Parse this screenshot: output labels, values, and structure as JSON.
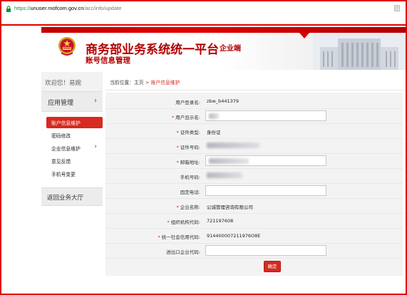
{
  "browser": {
    "url_scheme": "https://",
    "url_host": "unuser.mofcom.gov.cn",
    "url_path": "/acc/info/update"
  },
  "header": {
    "title": "商务部业务系统统一平台",
    "suffix": "企业端",
    "subtitle": "账号信息管理"
  },
  "sidebar": {
    "welcome": "欢迎您！易婉",
    "menu_head": "应用管理",
    "menu_arrow": "›",
    "items": [
      {
        "label": "账户信息维护",
        "active": true
      },
      {
        "label": "密码修改"
      },
      {
        "label": "企业信息维护",
        "arrow": "›"
      },
      {
        "label": "意见反馈"
      },
      {
        "label": "手机号变更"
      }
    ],
    "return_label": "返回业务大厅"
  },
  "breadcrumb": {
    "prefix": "当前位置：",
    "home": "主页",
    "sep": " > ",
    "current": "账户信息维护"
  },
  "form": {
    "rows": [
      {
        "required": false,
        "label": "用户登录名:",
        "type": "text",
        "value": "zbw_b441379"
      },
      {
        "required": true,
        "label": "用户显示名:",
        "type": "input",
        "value": ""
      },
      {
        "required": true,
        "label": "证件类型:",
        "type": "text",
        "value": "身份证"
      },
      {
        "required": true,
        "label": "证件号码:",
        "type": "text",
        "value": ""
      },
      {
        "required": true,
        "label": "邮箱地址:",
        "type": "input",
        "value": ""
      },
      {
        "required": false,
        "label": "手机号码:",
        "type": "text",
        "value": ""
      },
      {
        "required": false,
        "label": "固定电话:",
        "type": "input",
        "value": ""
      },
      {
        "required": true,
        "label": "企业名称:",
        "type": "text",
        "value": "公诚管理咨询有限公司"
      },
      {
        "required": true,
        "label": "组织机构代码:",
        "type": "text",
        "value": "721197608"
      },
      {
        "required": true,
        "label": "统一社会信用代码:",
        "type": "text",
        "value": "914400007211976O8E"
      },
      {
        "required": false,
        "label": "进出口企业代码:",
        "type": "input",
        "value": ""
      }
    ],
    "required_mark": "* ",
    "confirm_label": "确定"
  },
  "colors": {
    "accent": "#d72a20",
    "brand_red": "#b40000",
    "frame_red": "#e00000"
  }
}
